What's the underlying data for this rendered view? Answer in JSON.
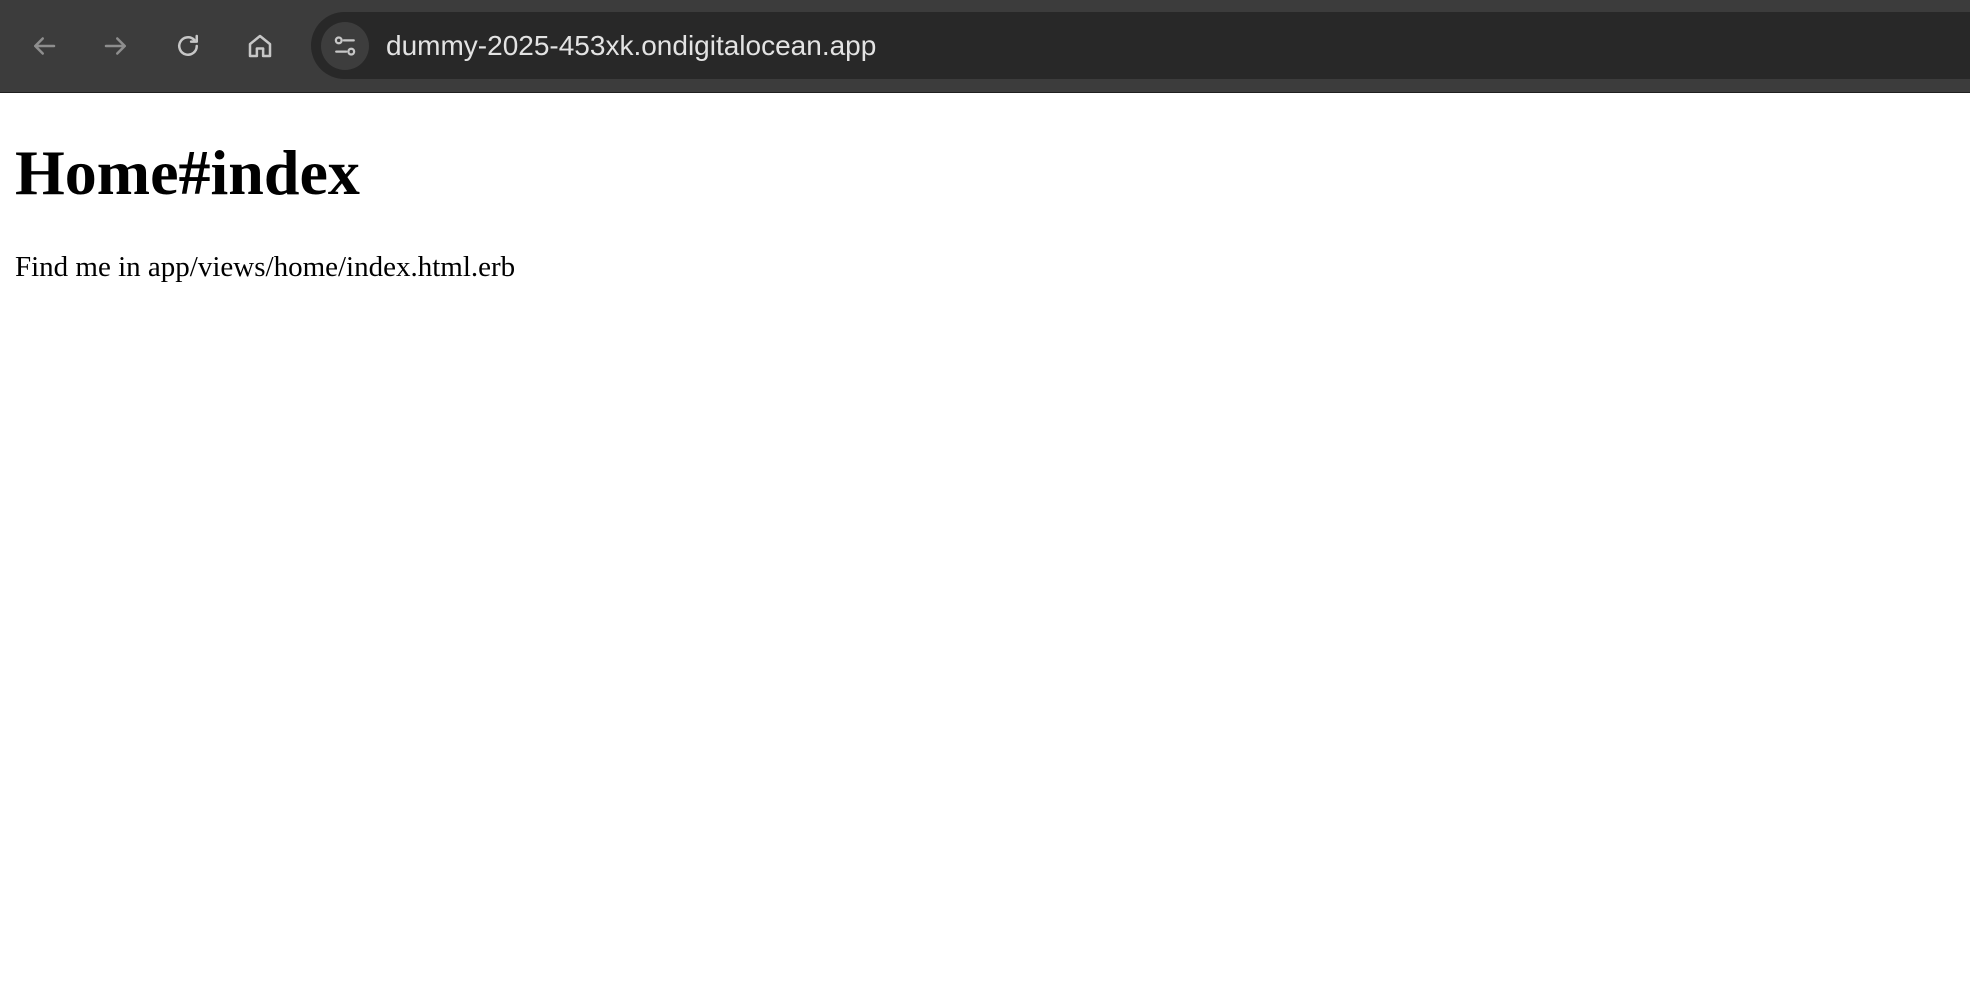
{
  "browser": {
    "url": "dummy-2025-453xk.ondigitalocean.app",
    "colors": {
      "toolbar": "#3c3c3c",
      "omnibox": "#282828",
      "icon_disabled": "#8e8e8e",
      "icon_enabled": "#c7c7c7"
    },
    "icons": {
      "back": "arrow-left-icon",
      "forward": "arrow-right-icon",
      "reload": "reload-icon",
      "home": "home-icon",
      "site_info": "tune-icon"
    }
  },
  "page": {
    "heading": "Home#index",
    "paragraph": "Find me in app/views/home/index.html.erb"
  }
}
